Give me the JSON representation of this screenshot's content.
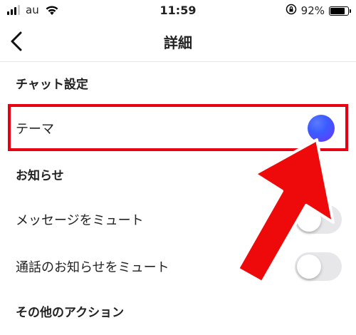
{
  "status_bar": {
    "carrier": "au",
    "time": "11:59",
    "battery_percent": "92%",
    "battery_level": 0.92
  },
  "header": {
    "title": "詳細"
  },
  "sections": {
    "chat_settings": {
      "title": "チャット設定",
      "theme_label": "テーマ",
      "theme_color": "#3b5bff"
    },
    "notifications": {
      "title": "お知らせ",
      "mute_messages_label": "メッセージをミュート",
      "mute_messages_on": false,
      "mute_calls_label": "通話のお知らせをミュート",
      "mute_calls_on": false
    },
    "other_actions": {
      "title": "その他のアクション"
    }
  },
  "annotation": {
    "highlight_color": "#e60012"
  }
}
